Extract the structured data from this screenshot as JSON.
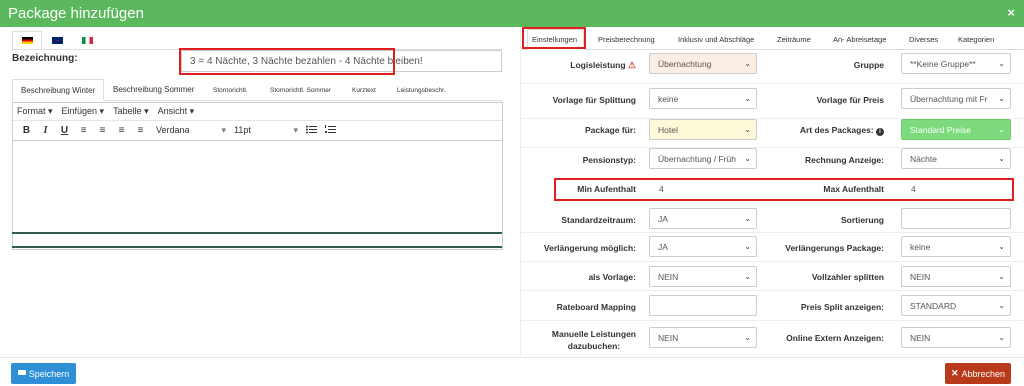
{
  "dialog": {
    "title": "Package hinzufügen",
    "close_icon": "×"
  },
  "languages": [
    {
      "code": "de",
      "colors": [
        "#000000",
        "#dd0000",
        "#ffce00"
      ],
      "active": true
    },
    {
      "code": "en",
      "colors": [
        "#012169",
        "#c8102e",
        "#ffffff"
      ],
      "active": false
    },
    {
      "code": "it",
      "colors": [
        "#009246",
        "#ffffff",
        "#ce2b37"
      ],
      "active": false
    }
  ],
  "bezeichnung": {
    "label": "Bezeichnung:",
    "value": "3 = 4 Nächte, 3 Nächte bezahlen - 4 Nächte bleiben!"
  },
  "desc_tabs": [
    "Beschreibung Winter",
    "Beschreibung Sommer",
    "Stornorichtl.",
    "Stornorichtl. Sommer",
    "Kurztext",
    "Leistungsbeschr."
  ],
  "editor": {
    "menu": [
      "Format ▾",
      "Einfügen ▾",
      "Tabelle ▾",
      "Ansicht ▾"
    ],
    "buttons": [
      "B",
      "I",
      "U",
      "≡",
      "≡",
      "≡",
      "≡"
    ],
    "font": "Verdana",
    "size": "11pt",
    "list_icons": [
      "bullet-list-icon",
      "numbered-list-icon"
    ]
  },
  "right_tabs": [
    "Einstellungen",
    "Preisberechnung",
    "Inklusiv und Abschläge",
    "Zeiträume",
    "An- Abreisetage",
    "Diverses",
    "Kategorien"
  ],
  "form": {
    "logisleistung": {
      "label": "Logisleistung",
      "value": "Übernachtung"
    },
    "gruppe": {
      "label": "Gruppe",
      "value": "**Keine Gruppe**"
    },
    "vorlage_splittung": {
      "label": "Vorlage für Splittung",
      "value": "keine"
    },
    "vorlage_preis": {
      "label": "Vorlage für Preis",
      "value": "Übernachtung mit Fr"
    },
    "package_fuer": {
      "label": "Package für:",
      "value": "Hotel"
    },
    "art_package": {
      "label": "Art des Packages:",
      "value": "Standard Preise"
    },
    "pensionstyp": {
      "label": "Pensionstyp:",
      "value": "Übernachtung / Früh"
    },
    "rechnung_anzeige": {
      "label": "Rechnung Anzeige:",
      "value": "Nächte"
    },
    "min_aufenthalt": {
      "label": "Min Aufenthalt",
      "value": "4"
    },
    "max_aufenthalt": {
      "label": "Max Aufenthalt",
      "value": "4"
    },
    "standardzeitraum": {
      "label": "Standardzeitraum:",
      "value": "JA"
    },
    "sortierung": {
      "label": "Sortierung",
      "value": ""
    },
    "verlaengerung_moeglich": {
      "label": "Verlängerung möglich:",
      "value": "JA"
    },
    "verlaengerungs_package": {
      "label": "Verlängerungs Package:",
      "value": "keine"
    },
    "als_vorlage": {
      "label": "als Vorlage:",
      "value": "NEIN"
    },
    "vollzahler_splitten": {
      "label": "Vollzahler splitten",
      "value": "NEIN"
    },
    "rateboard_mapping": {
      "label": "Rateboard Mapping",
      "value": ""
    },
    "preis_split": {
      "label": "Preis Split anzeigen:",
      "value": "STANDARD"
    },
    "manuelle_leistungen": {
      "label1": "Manuelle Leistungen",
      "label2": "dazubuchen:",
      "value": "NEIN"
    },
    "online_extern": {
      "label": "Online Extern Anzeigen:",
      "value": "NEIN"
    }
  },
  "footer": {
    "save": "Speichern",
    "cancel": "Abbrechen"
  },
  "colors": {
    "title_bar": "#5cb85c",
    "save": "#2f8fd6",
    "cancel": "#b93a1a",
    "highlight": "#e02020",
    "logis_bg": "#fbeee4",
    "hotel_bg": "#fcf8d8",
    "standard_bg": "#7ddb7d"
  }
}
